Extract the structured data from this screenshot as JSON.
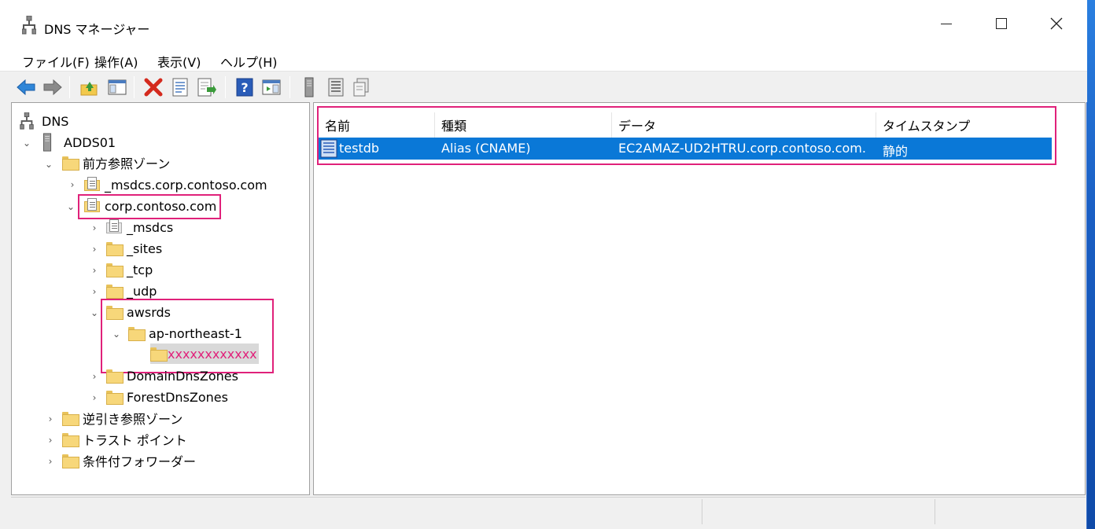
{
  "window": {
    "title": "DNS マネージャー"
  },
  "menu": [
    "ファイル(F)",
    "操作(A)",
    "表示(V)",
    "ヘルプ(H)"
  ],
  "toolbar": [
    "back-icon",
    "forward-icon",
    "up-folder-icon",
    "show-hide-tree-icon",
    "delete-icon",
    "properties-icon",
    "export-list-icon",
    "help-icon",
    "show-hide-action-pane-icon",
    "server-icon",
    "record-list-icon",
    "copy-icon"
  ],
  "tree": {
    "dns": "DNS",
    "server": "ADDS01",
    "forward": "前方参照ゾーン",
    "msdcs_zone": "_msdcs.corp.contoso.com",
    "corp": "corp.contoso.com",
    "msdcs": "_msdcs",
    "sites": "_sites",
    "tcp": "_tcp",
    "udp": "_udp",
    "awsrds": "awsrds",
    "region": "ap-northeast-1",
    "masked": "xxxxxxxxxxxx",
    "domaindns": "DomainDnsZones",
    "forestdns": "ForestDnsZones",
    "reverse": "逆引き参照ゾーン",
    "trust": "トラスト ポイント",
    "conditional": "条件付フォワーダー"
  },
  "list": {
    "columns": [
      "名前",
      "種類",
      "データ",
      "タイムスタンプ"
    ],
    "rows": [
      {
        "name": "testdb",
        "type": "Alias (CNAME)",
        "data": "EC2AMAZ-UD2HTRU.corp.contoso.com.",
        "timestamp": "静的"
      }
    ]
  },
  "colors": {
    "selection": "#0a78d7",
    "highlight": "#e0217a",
    "desktop": "#1e6fd0"
  }
}
